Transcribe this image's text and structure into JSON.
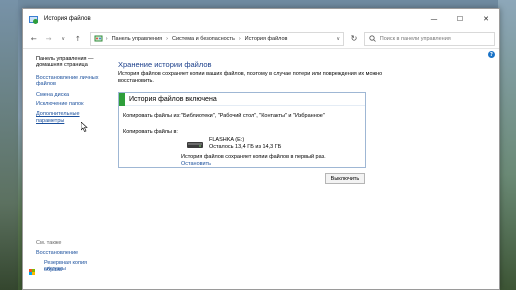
{
  "window": {
    "title": "История файлов",
    "controls": {
      "minimize": "—",
      "maximize": "☐",
      "close": "✕"
    }
  },
  "nav": {
    "back": "←",
    "forward": "→",
    "recent": "∨",
    "up": "↑",
    "breadcrumbs": [
      "Панель управления",
      "Система и безопасность",
      "История файлов"
    ],
    "breadcrumb_sep": "›",
    "dropdown": "∨",
    "refresh": "↻",
    "search_placeholder": "Поиск в панели управления"
  },
  "sidebar": {
    "items": [
      {
        "label": "Панель управления —"
      },
      {
        "label": "домашняя страница"
      },
      {
        "label": "Восстановление личных"
      },
      {
        "label": "файлов"
      },
      {
        "label": "Смена диска"
      },
      {
        "label": "Исключение папок"
      },
      {
        "label": "Дополнительные параметры"
      }
    ],
    "see_also_heading": "См. также",
    "see_also": [
      {
        "label": "Восстановление"
      },
      {
        "label": "Резервная копия образа"
      },
      {
        "label": "системы"
      }
    ]
  },
  "main": {
    "title": "Хранение истории файлов",
    "description_line1": "История файлов сохраняет копии ваших файлов, поэтому в случае потери или повреждения их можно",
    "description_line2": "восстановить.",
    "panel": {
      "title": "История файлов включена",
      "copy_from_label": "Копировать файлы из:",
      "copy_from_value": "\"Библиотеки\", \"Рабочий стол\", \"Контакты\" и \"Избранное\"",
      "copy_to_label": "Копировать файлы в:",
      "drive_name": "FLASHKA (E:)",
      "drive_free": "Осталось 13,4 ГБ из 14,3 ГБ",
      "note": "История файлов сохраняет копии файлов в первый раз.",
      "stop_link": "Остановить"
    },
    "turn_off_button": "Выключить",
    "help": "?"
  },
  "colors": {
    "link": "#1a4f9c",
    "title": "#1a3e8a",
    "status_on": "#2e9e3a",
    "help": "#1a73c7"
  }
}
